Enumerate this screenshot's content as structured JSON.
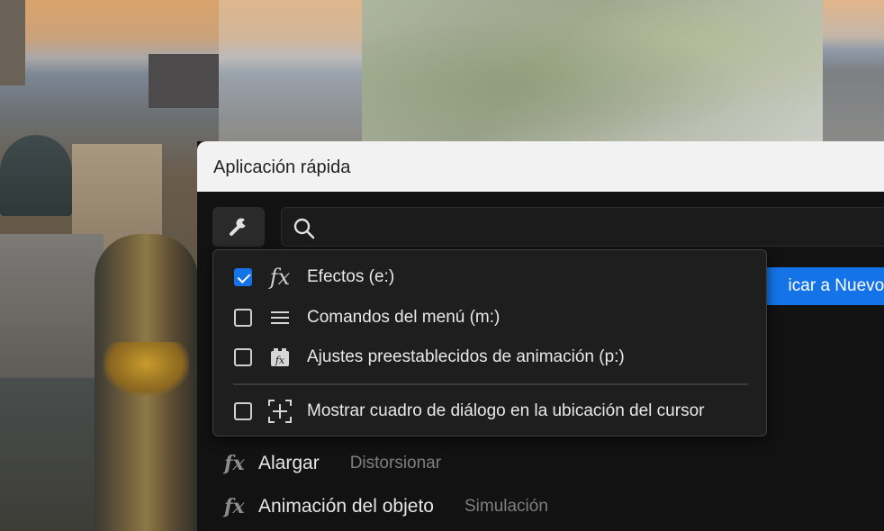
{
  "dialog": {
    "title": "Aplicación rápida",
    "apply_button_visible_text": "icar a Nuevo s"
  },
  "menu": {
    "items": [
      {
        "label": "Efectos (e:)",
        "checked": true,
        "icon": "fx-icon"
      },
      {
        "label": "Comandos del menú (m:)",
        "checked": false,
        "icon": "menu-lines-icon"
      },
      {
        "label": "Ajustes preestablecidos de animación (p:)",
        "checked": false,
        "icon": "animation-preset-icon"
      },
      {
        "label": "Mostrar cuadro de diálogo en la ubicación del cursor",
        "checked": false,
        "icon": "cursor-location-icon"
      }
    ]
  },
  "results": [
    {
      "icon": "fx",
      "name": "Alargar",
      "category": "Distorsionar"
    },
    {
      "icon": "fx",
      "name": "Animación del objeto",
      "category": "Simulación"
    }
  ],
  "colors": {
    "accent": "#1473e6",
    "dialog_bg": "#121212",
    "titlebar_bg": "#f2f2f2"
  }
}
